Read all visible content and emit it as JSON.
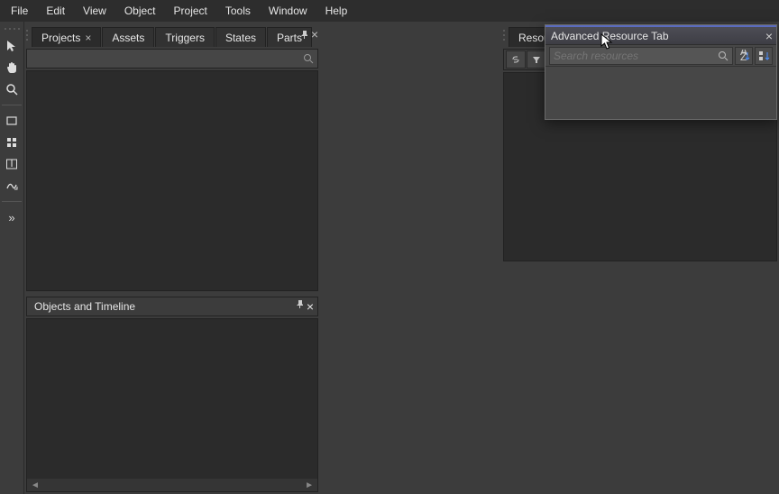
{
  "menu": [
    "File",
    "Edit",
    "View",
    "Object",
    "Project",
    "Tools",
    "Window",
    "Help"
  ],
  "tools": {
    "items": [
      "select",
      "pan",
      "zoom",
      "rect",
      "grid",
      "text",
      "path"
    ],
    "expand": "»"
  },
  "tabs": {
    "items": [
      {
        "label": "Projects",
        "closable": true
      },
      {
        "label": "Assets",
        "closable": false
      },
      {
        "label": "Triggers",
        "closable": false
      },
      {
        "label": "States",
        "closable": false
      },
      {
        "label": "Parts",
        "closable": false
      }
    ],
    "active": 0,
    "pin": "📌",
    "close": "×"
  },
  "objects_panel": {
    "title": "Objects and Timeline"
  },
  "right": {
    "tab_label": "Resources",
    "toolbar": [
      "link",
      "filter"
    ]
  },
  "popup": {
    "title": "Advanced Resource Tab",
    "search_placeholder": "Search resources"
  }
}
